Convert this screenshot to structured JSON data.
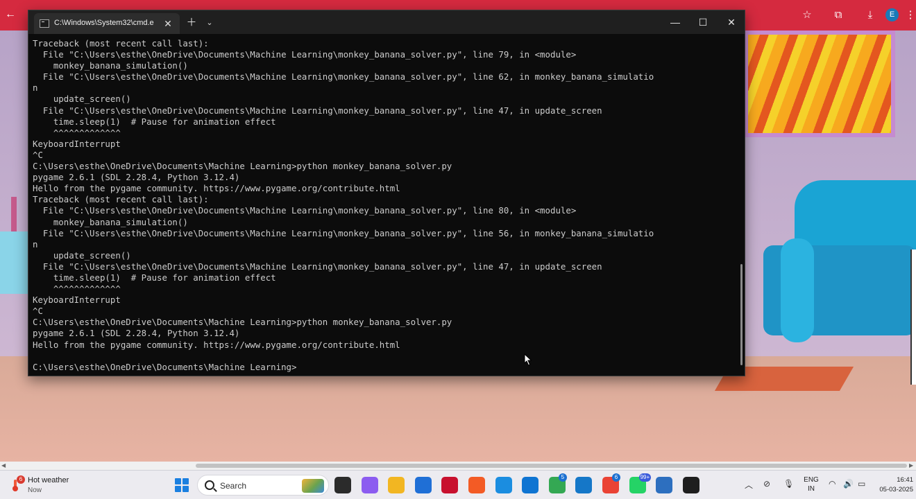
{
  "terminal": {
    "tab_title": "C:\\Windows\\System32\\cmd.e",
    "lines": [
      "Traceback (most recent call last):",
      "  File \"C:\\Users\\esthe\\OneDrive\\Documents\\Machine Learning\\monkey_banana_solver.py\", line 79, in <module>",
      "    monkey_banana_simulation()",
      "  File \"C:\\Users\\esthe\\OneDrive\\Documents\\Machine Learning\\monkey_banana_solver.py\", line 62, in monkey_banana_simulatio",
      "n",
      "    update_screen()",
      "  File \"C:\\Users\\esthe\\OneDrive\\Documents\\Machine Learning\\monkey_banana_solver.py\", line 47, in update_screen",
      "    time.sleep(1)  # Pause for animation effect",
      "    ^^^^^^^^^^^^^",
      "KeyboardInterrupt",
      "^C",
      "C:\\Users\\esthe\\OneDrive\\Documents\\Machine Learning>python monkey_banana_solver.py",
      "pygame 2.6.1 (SDL 2.28.4, Python 3.12.4)",
      "Hello from the pygame community. https://www.pygame.org/contribute.html",
      "Traceback (most recent call last):",
      "  File \"C:\\Users\\esthe\\OneDrive\\Documents\\Machine Learning\\monkey_banana_solver.py\", line 80, in <module>",
      "    monkey_banana_simulation()",
      "  File \"C:\\Users\\esthe\\OneDrive\\Documents\\Machine Learning\\monkey_banana_solver.py\", line 56, in monkey_banana_simulatio",
      "n",
      "    update_screen()",
      "  File \"C:\\Users\\esthe\\OneDrive\\Documents\\Machine Learning\\monkey_banana_solver.py\", line 47, in update_screen",
      "    time.sleep(1)  # Pause for animation effect",
      "    ^^^^^^^^^^^^^",
      "KeyboardInterrupt",
      "^C",
      "C:\\Users\\esthe\\OneDrive\\Documents\\Machine Learning>python monkey_banana_solver.py",
      "pygame 2.6.1 (SDL 2.28.4, Python 3.12.4)",
      "Hello from the pygame community. https://www.pygame.org/contribute.html",
      "",
      "C:\\Users\\esthe\\OneDrive\\Documents\\Machine Learning>"
    ],
    "colors": {
      "background": "#0c0c0c",
      "text": "#cccccc",
      "titlebar": "#1f1f1f"
    }
  },
  "browser": {
    "profile_initial": "E",
    "accent_color": "#d52a3f"
  },
  "taskbar": {
    "weather": {
      "badge": "6",
      "title": "Hot weather",
      "subtitle": "Now"
    },
    "search_placeholder": "Search",
    "apps": [
      {
        "name": "file-manager-icon",
        "color": "#2b2b2b"
      },
      {
        "name": "copilot-icon",
        "color": "#8c5cf0"
      },
      {
        "name": "file-explorer-icon",
        "color": "#f2b622"
      },
      {
        "name": "microsoft-store-icon",
        "color": "#1f6fd6"
      },
      {
        "name": "mcafee-icon",
        "color": "#c8102e"
      },
      {
        "name": "brave-browser-icon",
        "color": "#f35b25"
      },
      {
        "name": "edge-browser-icon",
        "color": "#1b8de0"
      },
      {
        "name": "edge-dev-icon",
        "color": "#0f74d2"
      },
      {
        "name": "chrome-icon",
        "color": "#34a853",
        "badge": "5"
      },
      {
        "name": "vscode-icon",
        "color": "#1577c8"
      },
      {
        "name": "chrome-profile-icon",
        "color": "#ea4335",
        "badge": "6"
      },
      {
        "name": "whatsapp-icon",
        "color": "#25d366",
        "badge": "99+"
      },
      {
        "name": "notepad-icon",
        "color": "#2d6fbf"
      },
      {
        "name": "terminal-icon",
        "color": "#1e1e1e"
      }
    ],
    "language": {
      "line1": "ENG",
      "line2": "IN"
    },
    "clock": {
      "time": "16:41",
      "date": "05-03-2025"
    }
  }
}
